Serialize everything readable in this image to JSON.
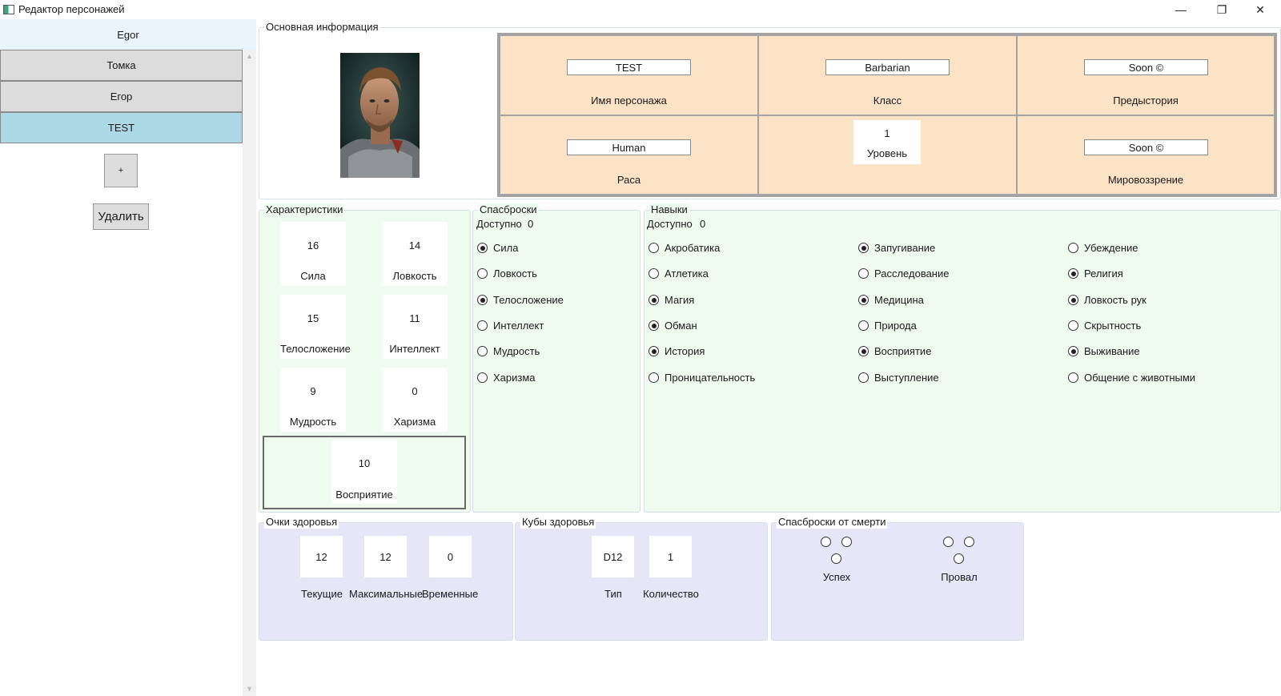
{
  "window": {
    "title": "Редактор персонажей",
    "controls": {
      "minimize": "—",
      "maximize": "❐",
      "close": "✕"
    }
  },
  "sidebar": {
    "header": "Egor",
    "characters": [
      {
        "name": "Томка",
        "selected": false
      },
      {
        "name": "Егор",
        "selected": false
      },
      {
        "name": "TEST",
        "selected": true
      }
    ],
    "add_label": "+",
    "delete_label": "Удалить"
  },
  "main_info": {
    "group_label": "Основная информация",
    "name": {
      "value": "TEST",
      "label": "Имя персонажа"
    },
    "class": {
      "value": "Barbarian",
      "label": "Класс"
    },
    "background": {
      "value": "Soon ©",
      "label": "Предыстория"
    },
    "race": {
      "value": "Human",
      "label": "Раса"
    },
    "level": {
      "value": "1",
      "label": "Уровень"
    },
    "alignment": {
      "value": "Soon ©",
      "label": "Мировоззрение"
    }
  },
  "stats": {
    "group_label": "Характеристики",
    "items": [
      {
        "value": "16",
        "label": "Сила"
      },
      {
        "value": "14",
        "label": "Ловкость"
      },
      {
        "value": "15",
        "label": "Телосложение"
      },
      {
        "value": "11",
        "label": "Интеллект"
      },
      {
        "value": "9",
        "label": "Мудрость"
      },
      {
        "value": "0",
        "label": "Харизма"
      }
    ],
    "perception": {
      "value": "10",
      "label": "Восприятие"
    }
  },
  "saves": {
    "group_label": "Спасброски",
    "available_label": "Доступно",
    "available_value": "0",
    "items": [
      {
        "label": "Сила",
        "checked": true
      },
      {
        "label": "Ловкость",
        "checked": false
      },
      {
        "label": "Телосложение",
        "checked": true
      },
      {
        "label": "Интеллект",
        "checked": false
      },
      {
        "label": "Мудрость",
        "checked": false
      },
      {
        "label": "Харизма",
        "checked": false
      }
    ]
  },
  "skills": {
    "group_label": "Навыки",
    "available_label": "Доступно",
    "available_value": "0",
    "columns": [
      [
        {
          "label": "Акробатика",
          "checked": false
        },
        {
          "label": "Атлетика",
          "checked": false
        },
        {
          "label": "Магия",
          "checked": true
        },
        {
          "label": "Обман",
          "checked": true
        },
        {
          "label": "История",
          "checked": true
        },
        {
          "label": "Проницательность",
          "checked": false
        }
      ],
      [
        {
          "label": "Запугивание",
          "checked": true
        },
        {
          "label": "Расследование",
          "checked": false
        },
        {
          "label": "Медицина",
          "checked": true
        },
        {
          "label": "Природа",
          "checked": false
        },
        {
          "label": "Восприятие",
          "checked": true
        },
        {
          "label": "Выступление",
          "checked": false
        }
      ],
      [
        {
          "label": "Убеждение",
          "checked": false
        },
        {
          "label": "Религия",
          "checked": true
        },
        {
          "label": "Ловкость рук",
          "checked": true
        },
        {
          "label": "Скрытность",
          "checked": false
        },
        {
          "label": "Выживание",
          "checked": true
        },
        {
          "label": "Общение с животными",
          "checked": false
        }
      ]
    ]
  },
  "hit_points": {
    "group_label": "Очки здоровья",
    "current": {
      "value": "12",
      "label": "Текущие"
    },
    "max": {
      "value": "12",
      "label": "Максимальные"
    },
    "temp": {
      "value": "0",
      "label": "Временные"
    }
  },
  "hit_dice": {
    "group_label": "Кубы здоровья",
    "type": {
      "value": "D12",
      "label": "Тип"
    },
    "count": {
      "value": "1",
      "label": "Количество"
    }
  },
  "death_saves": {
    "group_label": "Спасброски от смерти",
    "success_label": "Успех",
    "fail_label": "Провал"
  }
}
